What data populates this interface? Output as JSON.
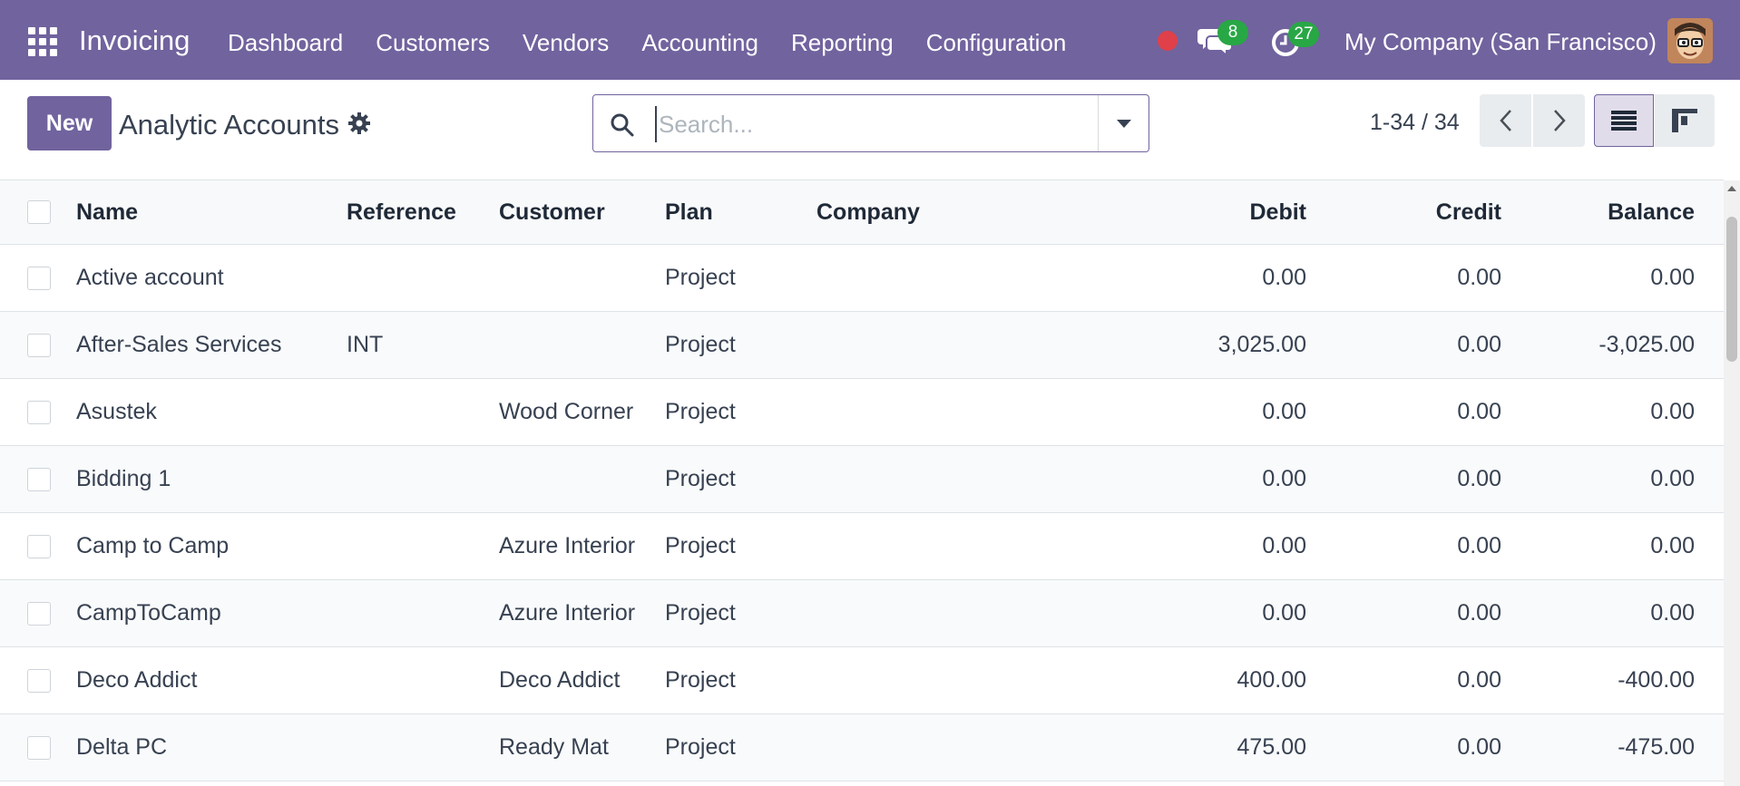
{
  "navbar": {
    "app_name": "Invoicing",
    "menu": [
      "Dashboard",
      "Customers",
      "Vendors",
      "Accounting",
      "Reporting",
      "Configuration"
    ],
    "messages_count": "8",
    "activities_count": "27",
    "company": "My Company (San Francisco)",
    "bg_color": "#71639e"
  },
  "control_panel": {
    "new_label": "New",
    "title": "Analytic Accounts",
    "search_placeholder": "Search...",
    "pager": "1-34 / 34"
  },
  "table": {
    "headers": {
      "name": "Name",
      "reference": "Reference",
      "customer": "Customer",
      "plan": "Plan",
      "company": "Company",
      "debit": "Debit",
      "credit": "Credit",
      "balance": "Balance"
    },
    "rows": [
      {
        "name": "Active account",
        "reference": "",
        "customer": "",
        "plan": "Project",
        "company": "",
        "debit": "0.00",
        "credit": "0.00",
        "balance": "0.00"
      },
      {
        "name": "After-Sales Services",
        "reference": "INT",
        "customer": "",
        "plan": "Project",
        "company": "",
        "debit": "3,025.00",
        "credit": "0.00",
        "balance": "-3,025.00"
      },
      {
        "name": "Asustek",
        "reference": "",
        "customer": "Wood Corner",
        "plan": "Project",
        "company": "",
        "debit": "0.00",
        "credit": "0.00",
        "balance": "0.00"
      },
      {
        "name": "Bidding 1",
        "reference": "",
        "customer": "",
        "plan": "Project",
        "company": "",
        "debit": "0.00",
        "credit": "0.00",
        "balance": "0.00"
      },
      {
        "name": "Camp to Camp",
        "reference": "",
        "customer": "Azure Interior",
        "plan": "Project",
        "company": "",
        "debit": "0.00",
        "credit": "0.00",
        "balance": "0.00"
      },
      {
        "name": "CampToCamp",
        "reference": "",
        "customer": "Azure Interior",
        "plan": "Project",
        "company": "",
        "debit": "0.00",
        "credit": "0.00",
        "balance": "0.00"
      },
      {
        "name": "Deco Addict",
        "reference": "",
        "customer": "Deco Addict",
        "plan": "Project",
        "company": "",
        "debit": "400.00",
        "credit": "0.00",
        "balance": "-400.00"
      },
      {
        "name": "Delta PC",
        "reference": "",
        "customer": "Ready Mat",
        "plan": "Project",
        "company": "",
        "debit": "475.00",
        "credit": "0.00",
        "balance": "-475.00"
      }
    ]
  }
}
